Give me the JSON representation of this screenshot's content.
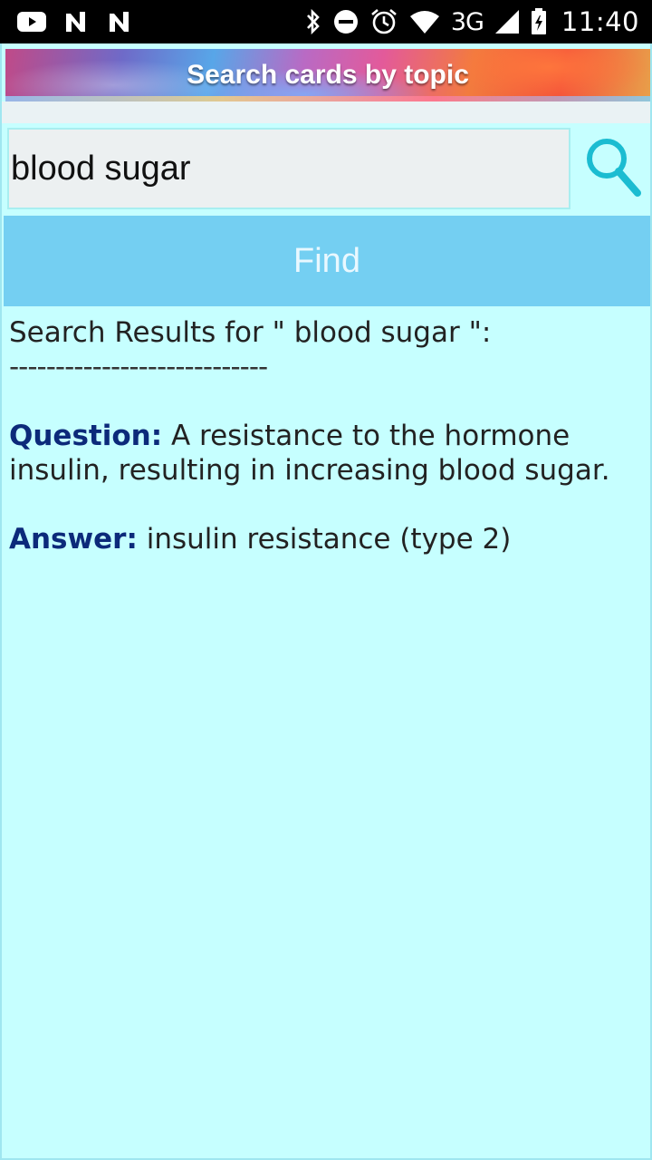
{
  "status_bar": {
    "time": "11:40",
    "network": "3G",
    "icons_left": [
      "youtube-icon",
      "n-app-icon",
      "n-app-icon"
    ],
    "icons_right": [
      "bluetooth-icon",
      "do-not-disturb-icon",
      "alarm-icon",
      "wifi-icon",
      "signal-icon",
      "battery-icon"
    ]
  },
  "header": {
    "title": "Search cards by topic"
  },
  "search": {
    "value": "blood sugar",
    "find_label": "Find"
  },
  "results": {
    "heading": "Search Results for \" blood sugar \":",
    "divider": "----------------------------",
    "items": [
      {
        "question_label": "Question:",
        "question_text": " A resistance to the hormone insulin, resulting in increasing blood sugar.",
        "answer_label": "Answer:",
        "answer_text": " insulin resistance (type 2)"
      }
    ]
  },
  "colors": {
    "background": "#c6ffff",
    "find_button": "#74cff2",
    "label_text": "#0c2a7a",
    "search_icon": "#1bbcd1"
  }
}
